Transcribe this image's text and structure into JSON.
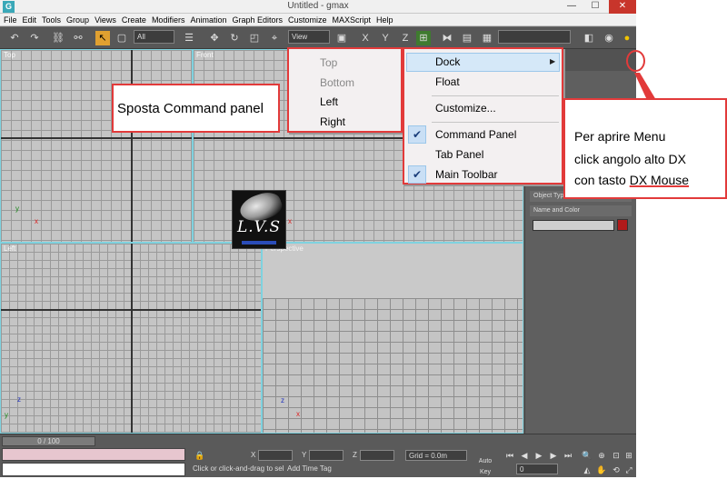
{
  "window": {
    "title": "Untitled - gmax",
    "logo_glyph": "G",
    "min_glyph": "—",
    "max_glyph": "☐",
    "close_glyph": "✕"
  },
  "menubar": {
    "items": [
      "File",
      "Edit",
      "Tools",
      "Group",
      "Views",
      "Create",
      "Modifiers",
      "Animation",
      "Graph Editors",
      "Customize",
      "MAXScript",
      "Help"
    ]
  },
  "toolbar": {
    "selection_filter": "All",
    "reference_coord": "View"
  },
  "viewports": {
    "top_label": "Top",
    "front_label": "Front",
    "left_label": "Left",
    "perspective_label": "Perspective",
    "axis_x": "x",
    "axis_y": "y",
    "axis_z": "z"
  },
  "command_panel": {
    "rollout_object_type": "Object Type",
    "rollout_name_color": "Name and Color"
  },
  "statusbar": {
    "time_slider": "0 / 100",
    "status_prompt": "Click or click-and-drag to select objects",
    "add_time_tag": "Add Time Tag",
    "x_label": "X",
    "y_label": "Y",
    "z_label": "Z",
    "grid": "Grid = 0.0m",
    "frame_value": "0",
    "auto_key": "Auto Key"
  },
  "annotation_left": {
    "text": "Sposta Command panel"
  },
  "dock_submenu": {
    "items": [
      "Top",
      "Bottom",
      "Left",
      "Right"
    ]
  },
  "context_menu": {
    "dock": "Dock",
    "float": "Float",
    "customize": "Customize...",
    "command_panel": "Command Panel",
    "tab_panel": "Tab Panel",
    "main_toolbar": "Main Toolbar",
    "check_glyph": "✔",
    "submenu_arrow": "▶"
  },
  "annotation_right": {
    "line1": "Per aprire Menu",
    "line2": "click angolo alto DX",
    "line3_prefix": "con tasto ",
    "line3_highlight": "DX Mouse"
  },
  "logo": {
    "text": "L.V.S"
  },
  "colors": {
    "annotation_red": "#e23a3a",
    "viewport_border": "#7fd2df",
    "menu_highlight": "#d5e8f8"
  }
}
